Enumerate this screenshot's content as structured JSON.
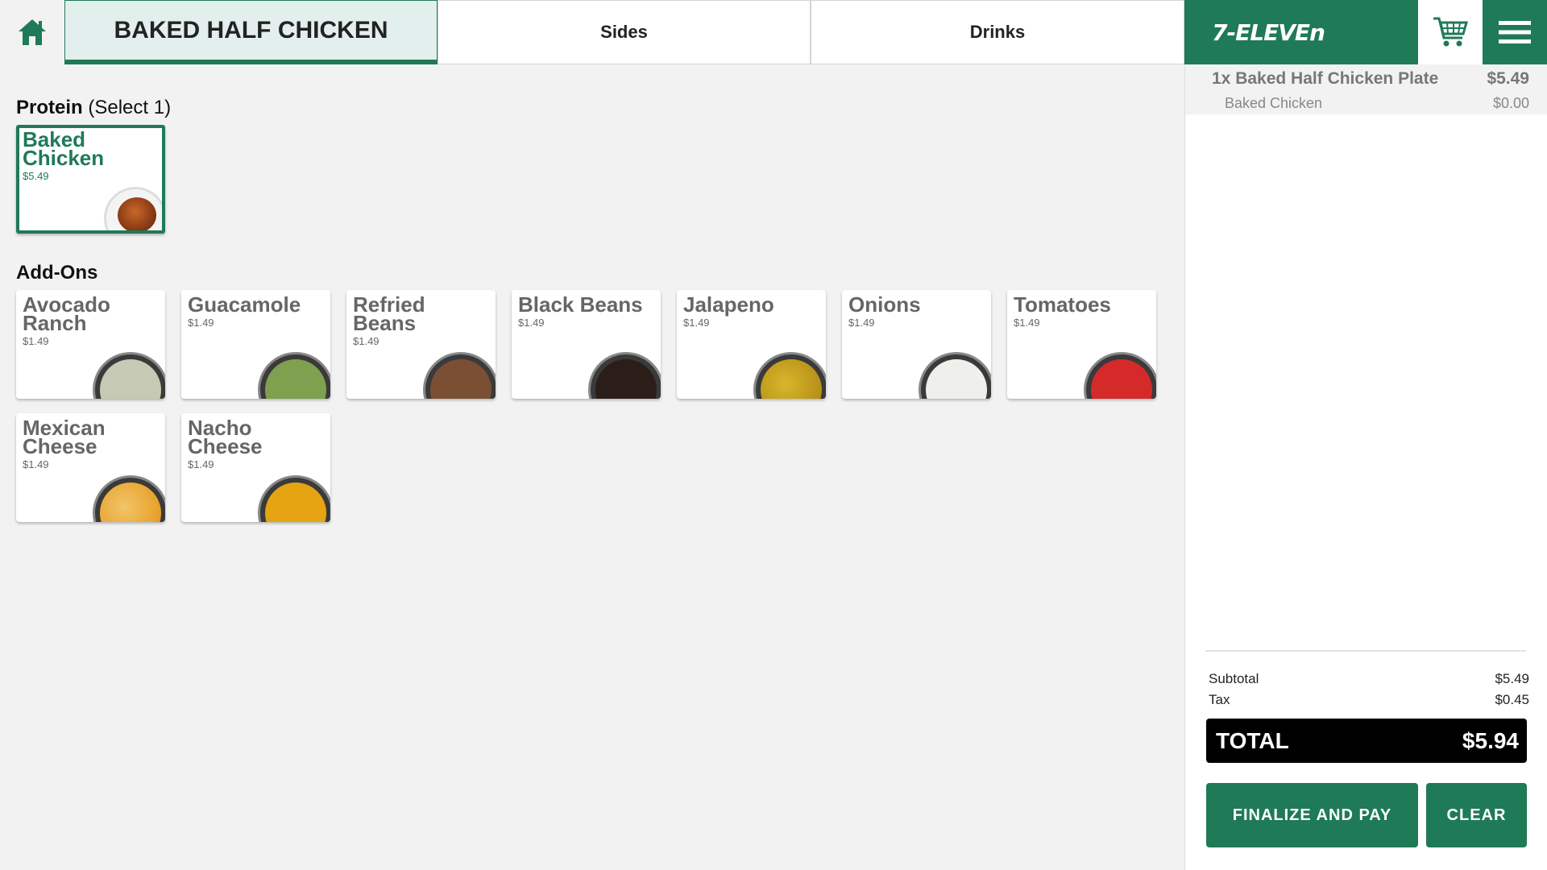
{
  "header": {
    "home_icon": "home-icon",
    "tabs": [
      {
        "label": "BAKED HALF CHICKEN",
        "active": true
      },
      {
        "label": "Sides",
        "active": false
      },
      {
        "label": "Drinks",
        "active": false
      }
    ],
    "brand": "7-ELEVEn",
    "cart_icon": "cart-icon",
    "menu_icon": "hamburger-menu-icon",
    "brand_color": "#1f7a57"
  },
  "protein": {
    "title": "Protein",
    "hint": "(Select 1)",
    "items": [
      {
        "name": "Baked Chicken",
        "price": "$5.49",
        "selected": true
      }
    ]
  },
  "addons": {
    "title": "Add-Ons",
    "items": [
      {
        "name": "Avocado Ranch",
        "price": "$1.49"
      },
      {
        "name": "Guacamole",
        "price": "$1.49"
      },
      {
        "name": "Refried Beans",
        "price": "$1.49"
      },
      {
        "name": "Black Beans",
        "price": "$1.49"
      },
      {
        "name": "Jalapeno",
        "price": "$1.49"
      },
      {
        "name": "Onions",
        "price": "$1.49"
      },
      {
        "name": "Tomatoes",
        "price": "$1.49"
      },
      {
        "name": "Mexican Cheese",
        "price": "$1.49"
      },
      {
        "name": "Nacho Cheese",
        "price": "$1.49"
      }
    ]
  },
  "order": {
    "line_item": {
      "qty_name": "1x Baked Half Chicken Plate",
      "price": "$5.49"
    },
    "sub_item": {
      "name": "Baked Chicken",
      "price": "$0.00"
    },
    "subtotal_label": "Subtotal",
    "subtotal": "$5.49",
    "tax_label": "Tax",
    "tax": "$0.45",
    "total_label": "TOTAL",
    "total": "$5.94",
    "finalize_label": "FINALIZE AND PAY",
    "clear_label": "CLEAR"
  }
}
